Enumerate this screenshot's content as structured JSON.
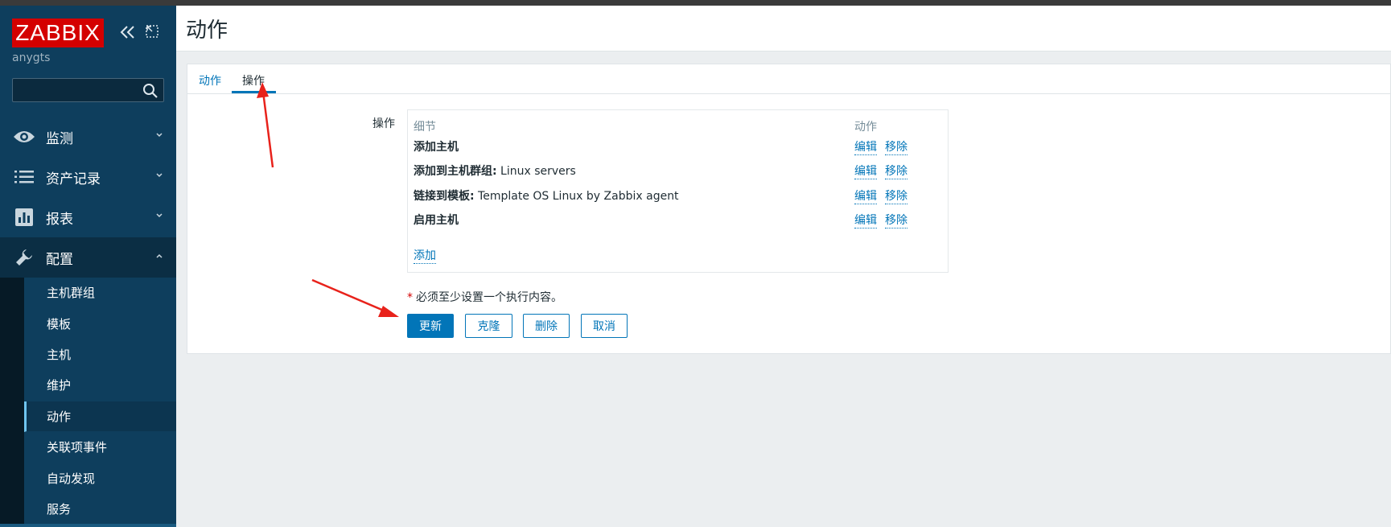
{
  "brand": {
    "logo_text": "ZABBIX",
    "server_name": "anygts",
    "accent": "#d40000"
  },
  "search": {
    "value": "",
    "placeholder": ""
  },
  "menu": [
    {
      "label": "监测",
      "icon": "eye-icon",
      "expanded": false
    },
    {
      "label": "资产记录",
      "icon": "list-icon",
      "expanded": false
    },
    {
      "label": "报表",
      "icon": "bar-chart-icon",
      "expanded": false
    },
    {
      "label": "配置",
      "icon": "wrench-icon",
      "expanded": true
    }
  ],
  "submenu": [
    {
      "label": "主机群组"
    },
    {
      "label": "模板"
    },
    {
      "label": "主机"
    },
    {
      "label": "维护"
    },
    {
      "label": "动作",
      "active": true
    },
    {
      "label": "关联项事件"
    },
    {
      "label": "自动发现"
    },
    {
      "label": "服务"
    }
  ],
  "page": {
    "title": "动作"
  },
  "tabs": [
    {
      "label": "动作"
    },
    {
      "label": "操作",
      "active": true
    }
  ],
  "operations": {
    "label": "操作",
    "col_detail": "细节",
    "col_action": "动作",
    "rows": [
      {
        "bold": "添加主机",
        "rest": ""
      },
      {
        "bold": "添加到主机群组:",
        "rest": " Linux servers"
      },
      {
        "bold": "链接到模板:",
        "rest": " Template OS Linux by Zabbix agent"
      },
      {
        "bold": "启用主机",
        "rest": ""
      }
    ],
    "edit_label": "编辑",
    "remove_label": "移除",
    "add_label": "添加"
  },
  "requirement_note": "必须至少设置一个执行内容。",
  "buttons": {
    "update": "更新",
    "clone": "克隆",
    "delete": "删除",
    "cancel": "取消"
  },
  "colors": {
    "sidebar": "#0e3e5d",
    "link": "#0275b8",
    "annotation_arrow": "#e8221b"
  }
}
